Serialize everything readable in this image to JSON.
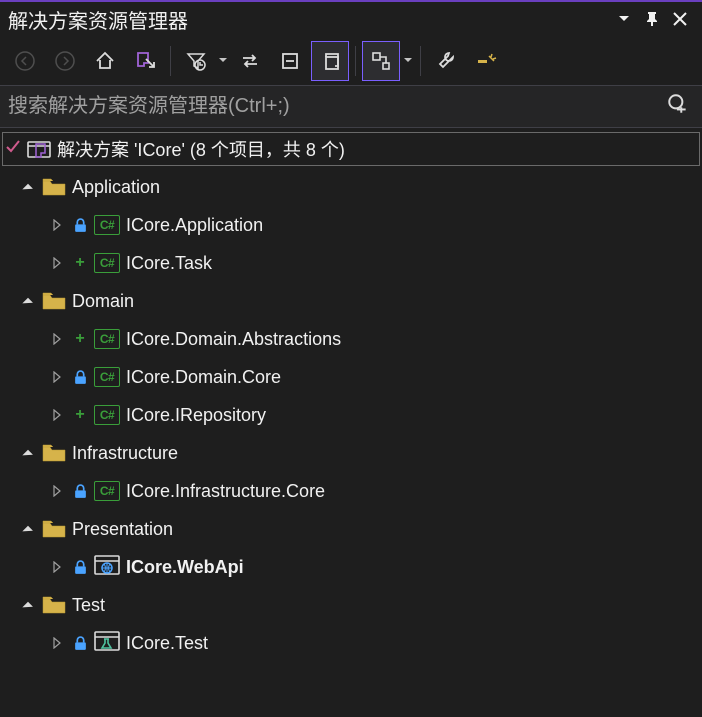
{
  "title": "解决方案资源管理器",
  "search": {
    "placeholder": "搜索解决方案资源管理器(Ctrl+;)"
  },
  "solution": {
    "label": "解决方案 'ICore' (8 个项目，共 8 个)"
  },
  "folders": [
    {
      "name": "Application",
      "items": [
        {
          "name": "ICore.Application",
          "vcs": "lock",
          "icon": "cs"
        },
        {
          "name": "ICore.Task",
          "vcs": "plus",
          "icon": "cs"
        }
      ]
    },
    {
      "name": "Domain",
      "items": [
        {
          "name": "ICore.Domain.Abstractions",
          "vcs": "plus",
          "icon": "cs"
        },
        {
          "name": "ICore.Domain.Core",
          "vcs": "lock",
          "icon": "cs"
        },
        {
          "name": "ICore.IRepository",
          "vcs": "plus",
          "icon": "cs"
        }
      ]
    },
    {
      "name": "Infrastructure",
      "items": [
        {
          "name": "ICore.Infrastructure.Core",
          "vcs": "lock",
          "icon": "cs"
        }
      ]
    },
    {
      "name": "Presentation",
      "items": [
        {
          "name": "ICore.WebApi",
          "vcs": "lock",
          "icon": "web",
          "bold": true
        }
      ]
    },
    {
      "name": "Test",
      "items": [
        {
          "name": "ICore.Test",
          "vcs": "lock",
          "icon": "test"
        }
      ]
    }
  ]
}
